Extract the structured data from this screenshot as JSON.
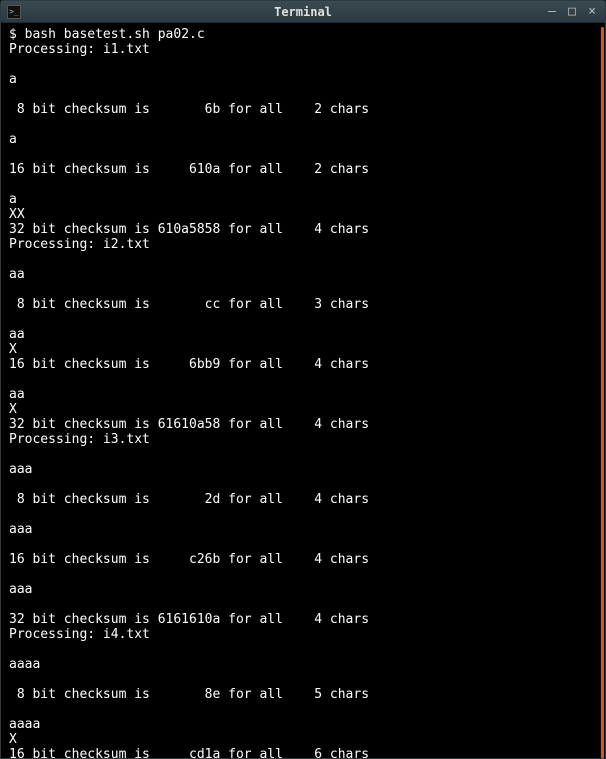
{
  "window": {
    "title": "Terminal"
  },
  "prompt": {
    "symbol": "$",
    "command": "bash basetest.sh pa02.c"
  },
  "output": {
    "lines": [
      "Processing: i1.txt",
      "",
      "a",
      "",
      " 8 bit checksum is       6b for all    2 chars",
      "",
      "a",
      "",
      "16 bit checksum is     610a for all    2 chars",
      "",
      "a",
      "XX",
      "32 bit checksum is 610a5858 for all    4 chars",
      "Processing: i2.txt",
      "",
      "aa",
      "",
      " 8 bit checksum is       cc for all    3 chars",
      "",
      "aa",
      "X",
      "16 bit checksum is     6bb9 for all    4 chars",
      "",
      "aa",
      "X",
      "32 bit checksum is 61610a58 for all    4 chars",
      "Processing: i3.txt",
      "",
      "aaa",
      "",
      " 8 bit checksum is       2d for all    4 chars",
      "",
      "aaa",
      "",
      "16 bit checksum is     c26b for all    4 chars",
      "",
      "aaa",
      "",
      "32 bit checksum is 6161610a for all    4 chars",
      "Processing: i4.txt",
      "",
      "aaaa",
      "",
      " 8 bit checksum is       8e for all    5 chars",
      "",
      "aaaa",
      "X",
      "16 bit checksum is     cd1a for all    6 chars"
    ]
  }
}
